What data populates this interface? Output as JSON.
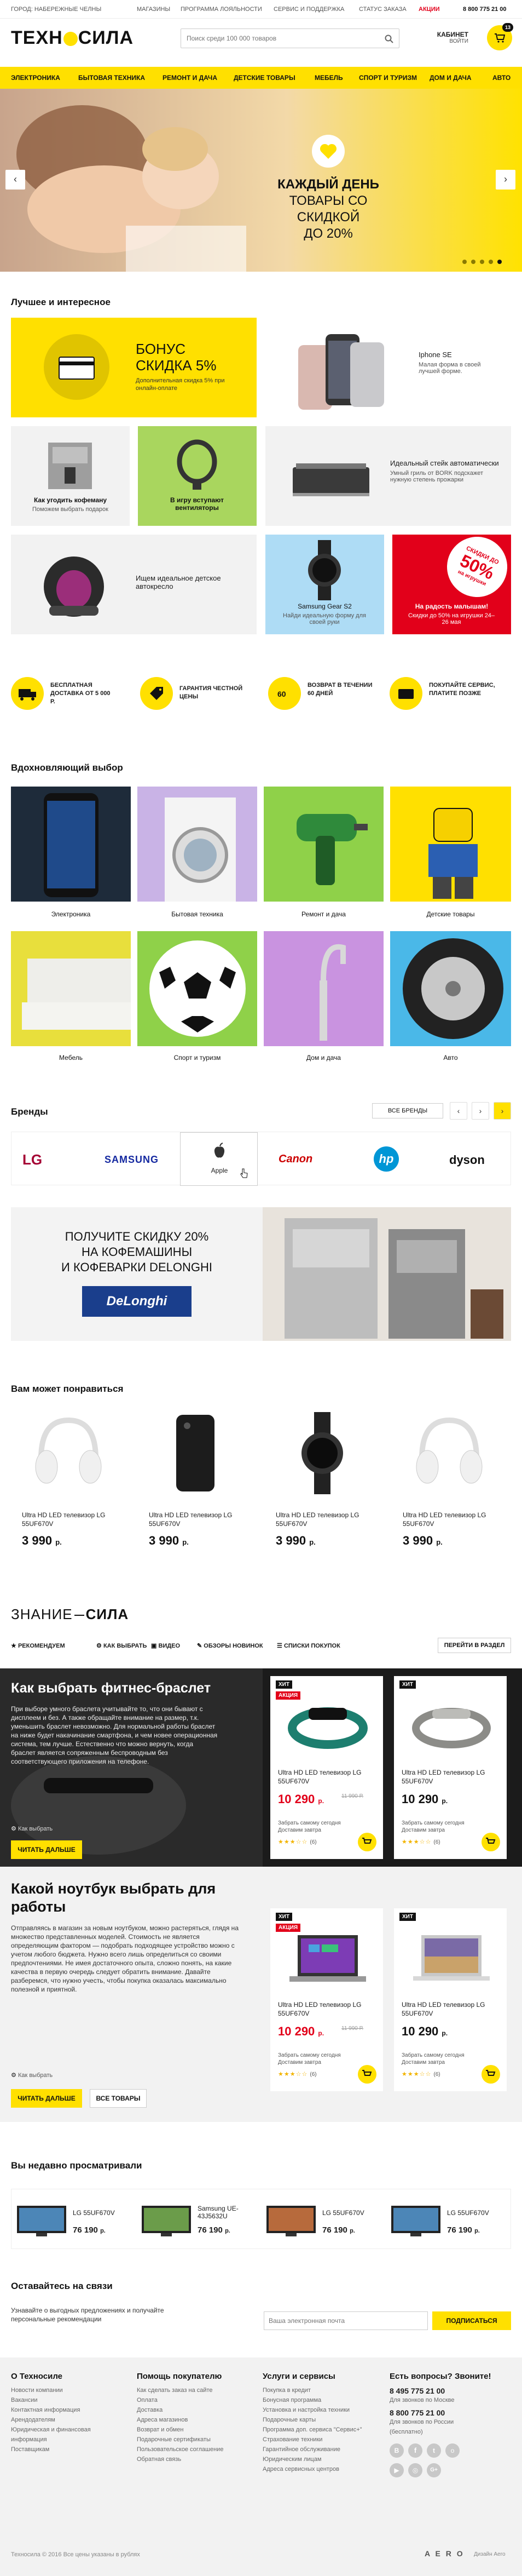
{
  "topbar": {
    "city": "ГОРОД: НАБЕРЕЖНЫЕ ЧЕЛНЫ",
    "links": [
      "МАГАЗИНЫ",
      "ПРОГРАММА ЛОЯЛЬНОСТИ",
      "СЕРВИС И ПОДДЕРЖКА",
      "СТАТУС ЗАКАЗА",
      "АКЦИИ"
    ],
    "phone": "8 800 775 21 00"
  },
  "header": {
    "logo_a": "ТЕХН",
    "logo_b": "СИЛА",
    "search_placeholder": "Поиск среди 100 000 товаров",
    "cabinet": "КАБИНЕТ",
    "login": "ВОЙТИ",
    "cart_count": "13"
  },
  "nav": [
    "ЭЛЕКТРОНИКА",
    "БЫТОВАЯ ТЕХНИКА",
    "РЕМОНТ И ДАЧА",
    "ДЕТСКИЕ ТОВАРЫ",
    "МЕБЕЛЬ",
    "СПОРТ И ТУРИЗМ",
    "ДОМ И ДАЧА",
    "АВТО"
  ],
  "hero": {
    "line1": "КАЖДЫЙ ДЕНЬ",
    "line2": "ТОВАРЫ СО СКИДКОЙ",
    "line3": "ДО 20%",
    "prev": "‹",
    "next": "›"
  },
  "best": {
    "title": "Лучшее и интересное",
    "bonus": {
      "title": "БОНУС",
      "subtitle": "СКИДКА 5%",
      "desc": "Дополнительная скидка 5% при онлайн-оплате"
    },
    "iphone": {
      "title": "Iphone SE",
      "desc": "Малая форма в своей лучшей форме."
    },
    "coffee": {
      "title": "Как угодить кофеману",
      "desc": "Поможем выбрать подарок"
    },
    "fans": {
      "title": "В игру вступают вентиляторы"
    },
    "grill": {
      "title": "Идеальный стейк автоматически",
      "desc": "Умный гриль от BORK подскажет нужную степень прожарки"
    },
    "seat": {
      "title": "Ищем идеальное детское автокресло"
    },
    "gear": {
      "title": "Samsung Gear S2",
      "desc": "Найди идеальную форму для своей руки"
    },
    "gift": {
      "title": "На радость малышам!",
      "desc": "Скидки до 50% на игрушки 24–26 мая",
      "badge_line1": "СКИДКИ ДО",
      "badge_line2": "50%",
      "badge_line3": "на игрушки"
    }
  },
  "benefits": [
    {
      "text": "БЕСПЛАТНАЯ ДОСТАВКА ОТ 5 000 Р."
    },
    {
      "text": "ГАРАНТИЯ ЧЕСТНОЙ ЦЕНЫ"
    },
    {
      "text": "ВОЗВРАТ В ТЕЧЕНИИ 60 ДНЕЙ"
    },
    {
      "text": "ПОКУПАЙТЕ СЕРВИС, ПЛАТИТЕ ПОЗЖЕ"
    }
  ],
  "inspire": {
    "title": "Вдохновляющий выбор",
    "cats": [
      "Электроника",
      "Бытовая техника",
      "Ремонт и дача",
      "Детские товары",
      "Мебель",
      "Спорт и туризм",
      "Дом и дача",
      "Авто"
    ]
  },
  "brands": {
    "title": "Бренды",
    "all": "ВСЕ БРЕНДЫ",
    "logos": [
      "LG",
      "SAMSUNG",
      "Apple",
      "Canon",
      "hp",
      "dyson"
    ]
  },
  "promo": {
    "line1": "ПОЛУЧИТЕ СКИДКУ 20%",
    "line2": "НА КОФЕМАШИНЫ",
    "line3": "И КОФЕВАРКИ DELONGHI",
    "brand": "DeLonghi"
  },
  "liked": {
    "title": "Вам может понравиться",
    "items": [
      {
        "name": "Ultra HD LED телевизор LG 55UF670V",
        "price": "3 990",
        "cur": "р."
      },
      {
        "name": "Ultra HD LED телевизор LG 55UF670V",
        "price": "3 990",
        "cur": "р."
      },
      {
        "name": "Ultra HD LED телевизор LG 55UF670V",
        "price": "3 990",
        "cur": "р."
      },
      {
        "name": "Ultra HD LED телевизор LG 55UF670V",
        "price": "3 990",
        "cur": "р."
      }
    ]
  },
  "znanie": {
    "logo_a": "ЗНАНИЕ",
    "logo_b": "СИЛА",
    "tabs": [
      "РЕКОМЕНДУЕМ",
      "КАК ВЫБРАТЬ",
      "ВИДЕО",
      "ОБЗОРЫ НОВИНОК",
      "СПИСКИ ПОКУПОК"
    ],
    "goto": "ПЕРЕЙТИ В РАЗДЕЛ"
  },
  "fitness": {
    "title": "Как выбрать фитнес-браслет",
    "text": "При выборе умного браслета учитывайте то, что они бывают с дисплеем и без. А также обращайте внимание на размер, т.к. уменьшить браслет невозможно. Для нормальной работы браслет на ниже будет накачинание смартфона, и чем новее операционная система, тем лучше. Естественно что можно вернуть, когда браслет является сопряженным беспроводным без соответствующего приложения на телефоне.",
    "howto": "Как выбрать",
    "btn": "ЧИТАТЬ ДАЛЬШЕ",
    "cards": [
      {
        "tag": "ХИТ",
        "tag2": "АКЦИЯ",
        "name": "Ultra HD LED телевизор LG 55UF670V",
        "price": "10 290",
        "cur": "р.",
        "old": "11 990 Р.",
        "stock": "Забрать самому сегодня Доставим завтра",
        "reviews": "(6)"
      },
      {
        "tag": "ХИТ",
        "name": "Ultra HD LED телевизор LG 55UF670V",
        "price": "10 290",
        "cur": "р.",
        "stock": "Забрать самому сегодня Доставим завтра",
        "reviews": "(6)"
      }
    ]
  },
  "laptop": {
    "title": "Какой ноутбук выбрать для работы",
    "text": "Отправляясь в магазин за новым ноутбуком, можно растеряться, глядя на множество представленных моделей. Стоимость не является определяющим фактором — подобрать подходящее устройство можно с учетом любого бюджета. Нужно всего лишь определиться со своими предпочтениями. Не имея достаточного опыта, сложно понять, на какие качества в первую очередь следует обратить внимание. Давайте разберемся, что нужно учесть, чтобы покупка оказалась максимально полезной и приятной.",
    "howto": "Как выбрать",
    "btn": "ЧИТАТЬ ДАЛЬШЕ",
    "btn2": "ВСЕ ТОВАРЫ",
    "cards": [
      {
        "tag": "ХИТ",
        "tag2": "АКЦИЯ",
        "name": "Ultra HD LED телевизор LG 55UF670V",
        "price": "10 290",
        "cur": "р.",
        "old": "11 990 Р.",
        "stock": "Забрать самому сегодня Доставим завтра",
        "reviews": "(6)"
      },
      {
        "tag": "ХИТ",
        "name": "Ultra HD LED телевизор LG 55UF670V",
        "price": "10 290",
        "cur": "р.",
        "stock": "Забрать самому сегодня Доставим завтра",
        "reviews": "(6)"
      }
    ]
  },
  "recent": {
    "title": "Вы недавно просматривали",
    "items": [
      {
        "name": "LG 55UF670V",
        "price": "76 190",
        "cur": "р."
      },
      {
        "name": "Samsung UE-43J5632U",
        "price": "76 190",
        "cur": "р."
      },
      {
        "name": "LG 55UF670V",
        "price": "76 190",
        "cur": "р."
      },
      {
        "name": "LG 55UF670V",
        "price": "76 190",
        "cur": "р."
      }
    ]
  },
  "subscribe": {
    "title": "Оставайтесь на связи",
    "desc": "Узнавайте о выгодных предложениях и получайте персональные рекомендации",
    "placeholder": "Ваша электронная почта",
    "btn": "ПОДПИСАТЬСЯ"
  },
  "footer": {
    "cols": [
      {
        "title": "О Техносиле",
        "links": [
          "Новости компании",
          "Вакансии",
          "Контактная информация",
          "Арендодателям",
          "Юридическая и финансовая информация",
          "Поставщикам"
        ]
      },
      {
        "title": "Помощь покупателю",
        "links": [
          "Как сделать заказ на сайте",
          "Оплата",
          "Доставка",
          "Адреса магазинов",
          "Возврат и обмен",
          "Подарочные сертификаты",
          "Пользовательское соглашение",
          "Обратная связь"
        ]
      },
      {
        "title": "Услуги и сервисы",
        "links": [
          "Покупка в кредит",
          "Бонусная программа",
          "Установка и настройка техники",
          "Подарочные карты",
          "Программа доп. сервиса \"Сервис+\"",
          "Страхование техники",
          "Гарантийное обслуживание",
          "Юридическим лицам",
          "Адреса сервисных центров"
        ]
      }
    ],
    "contact": {
      "title": "Есть вопросы? Звоните!",
      "phone1": "8 495 775 21 00",
      "note1": "Для звонков по Москве",
      "phone2": "8 800 775 21 00",
      "note2": "Для звонков по России (бесплатно)"
    },
    "copyright": "Техносила © 2016 Все цены указаны в рублях",
    "aero": "A E R O",
    "aero_note": "Дизайн Aero"
  },
  "colors": {
    "accent": "#ffe000",
    "text": "#1c1c1c",
    "sale": "#e2001a",
    "dark": "#111111"
  }
}
